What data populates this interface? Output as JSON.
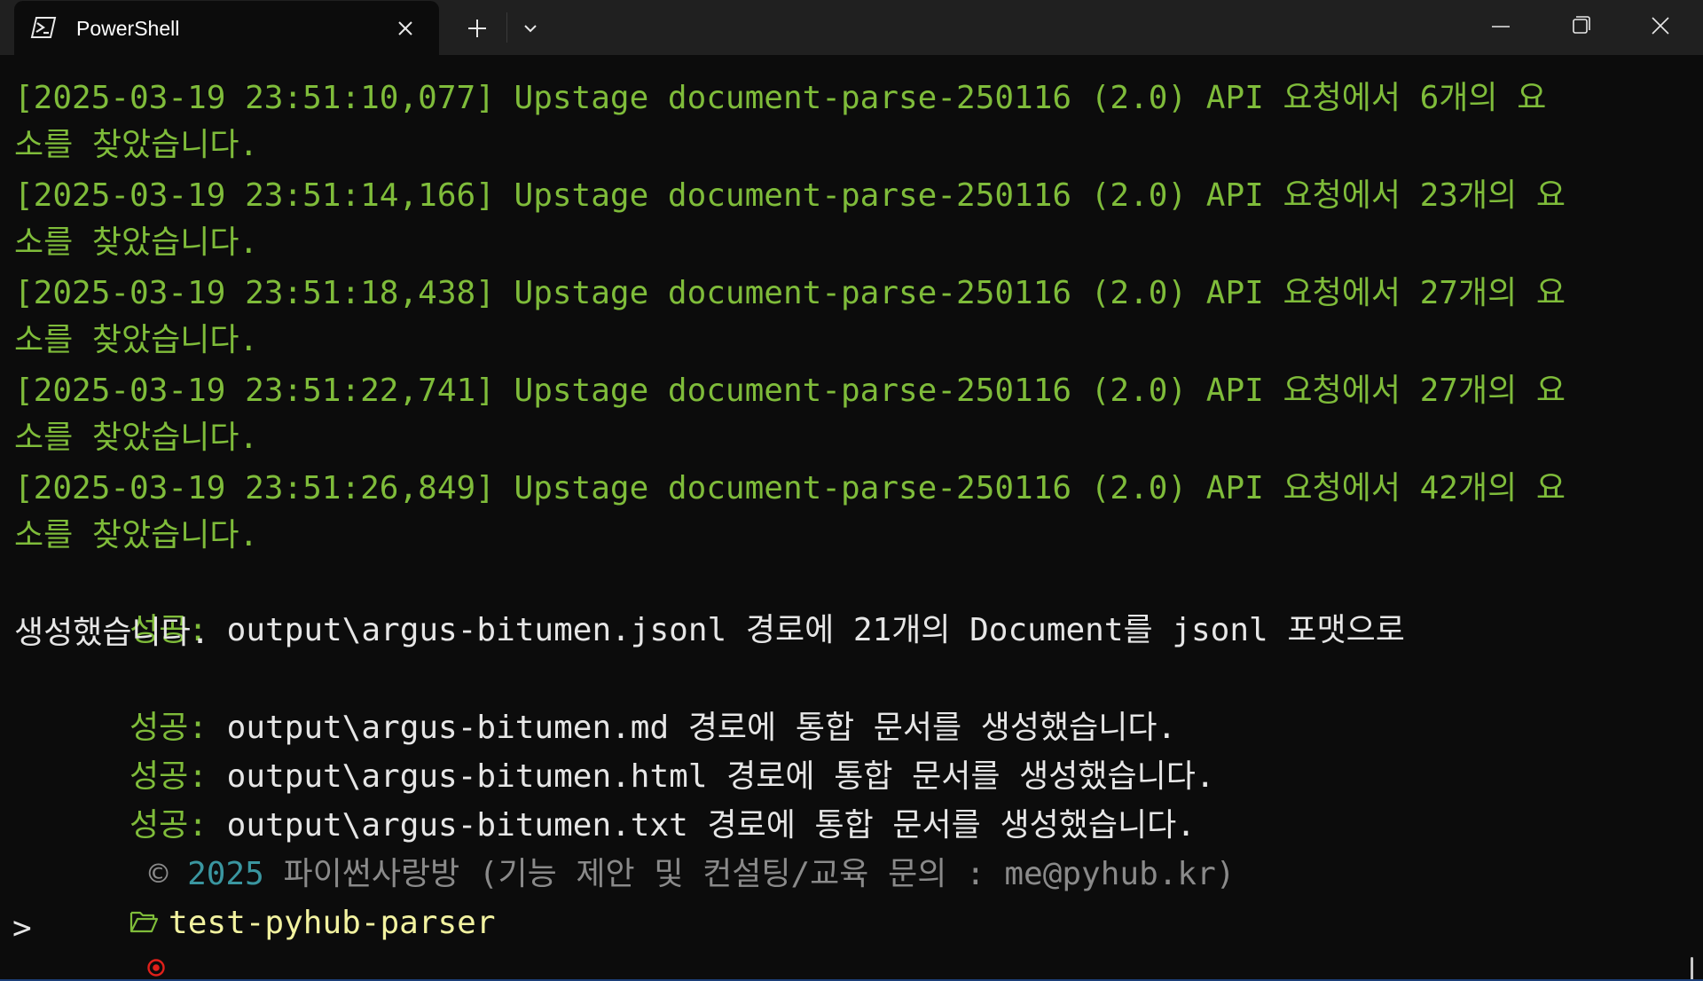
{
  "window": {
    "tab_title": "PowerShell",
    "tab_icon": "powershell-icon",
    "controls": [
      "new-tab-icon",
      "chevron-down-icon",
      "minimize-icon",
      "maximize-icon",
      "close-icon"
    ]
  },
  "terminal": {
    "log_lines": [
      {
        "line1": "[2025-03-19 23:51:10,077] Upstage document-parse-250116 (2.0) API 요청에서 6개의 요",
        "line2": "소를 찾았습니다."
      },
      {
        "line1": "[2025-03-19 23:51:14,166] Upstage document-parse-250116 (2.0) API 요청에서 23개의 요",
        "line2": "소를 찾았습니다."
      },
      {
        "line1": "[2025-03-19 23:51:18,438] Upstage document-parse-250116 (2.0) API 요청에서 27개의 요",
        "line2": "소를 찾았습니다."
      },
      {
        "line1": "[2025-03-19 23:51:22,741] Upstage document-parse-250116 (2.0) API 요청에서 27개의 요",
        "line2": "소를 찾았습니다."
      },
      {
        "line1": "[2025-03-19 23:51:26,849] Upstage document-parse-250116 (2.0) API 요청에서 42개의 요",
        "line2": "소를 찾았습니다."
      }
    ],
    "success_prefix": "성공:",
    "success_lines": [
      {
        "text": " output\\argus-bitumen.jsonl 경로에 21개의 Document를 jsonl 포맷으로",
        "continuation": "생성했습니다."
      },
      {
        "text": " output\\argus-bitumen.md 경로에 통합 문서를 생성했습니다."
      },
      {
        "text": " output\\argus-bitumen.html 경로에 통합 문서를 생성했습니다."
      },
      {
        "text": " output\\argus-bitumen.txt 경로에 통합 문서를 생성했습니다."
      }
    ],
    "footer": {
      "copyright_symbol": " ©",
      "year": " 2025",
      "text": " 파이썬사랑방 (기능 제안 및 컨설팅/교육 문의 : me@pyhub.kr)"
    },
    "prompt": {
      "folder_icon": "folder-open-icon",
      "directory": "test-pyhub-parser",
      "status_icon": "record-icon",
      "symbol": ">"
    }
  },
  "colors": {
    "background": "#0c0c0c",
    "titlebar": "#202020",
    "log_green": "#7fbc3a",
    "text_white": "#e6e6e6",
    "footer_gray": "#8a8a8a",
    "year_teal": "#3a96a0",
    "prompt_yellow": "#f2f2a0",
    "status_red": "#e0201a"
  }
}
